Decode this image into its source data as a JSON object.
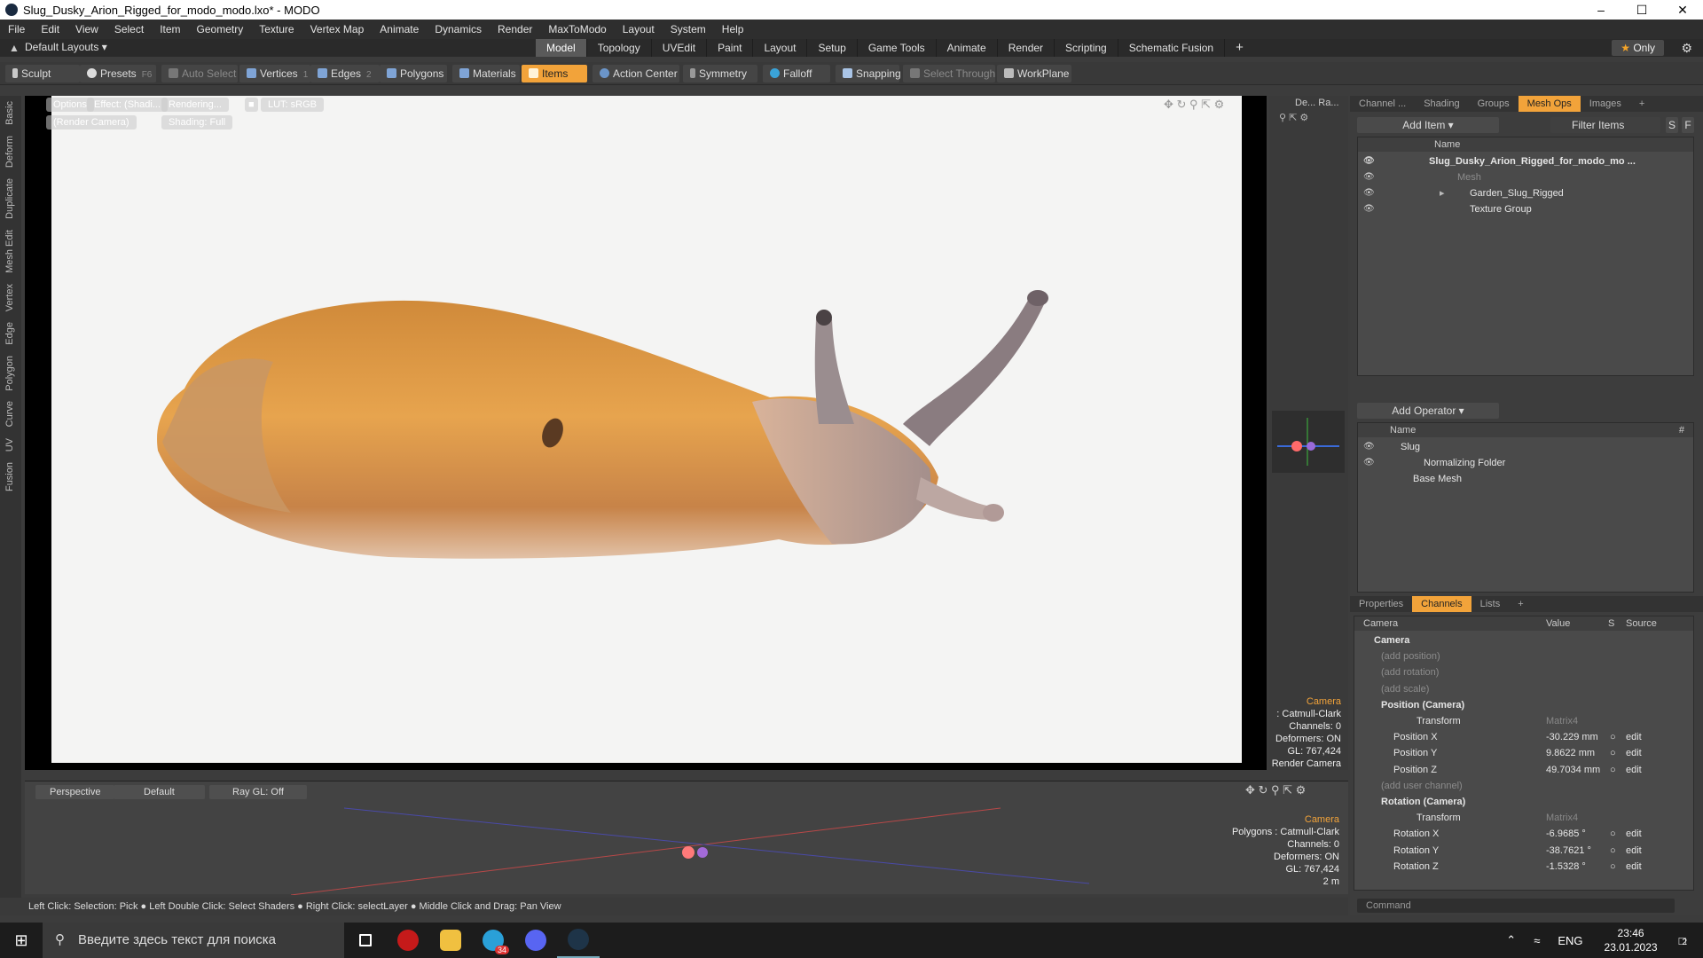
{
  "window": {
    "title": "Slug_Dusky_Arion_Rigged_for_modo_modo.lxo* - MODO"
  },
  "menu": [
    "File",
    "Edit",
    "View",
    "Select",
    "Item",
    "Geometry",
    "Texture",
    "Vertex Map",
    "Animate",
    "Dynamics",
    "Render",
    "MaxToModo",
    "Layout",
    "System",
    "Help"
  ],
  "layout_selector": "Default Layouts",
  "layout_tabs": [
    {
      "label": "Model",
      "active": true
    },
    {
      "label": "Topology"
    },
    {
      "label": "UVEdit"
    },
    {
      "label": "Paint"
    },
    {
      "label": "Layout"
    },
    {
      "label": "Setup"
    },
    {
      "label": "Game Tools"
    },
    {
      "label": "Animate"
    },
    {
      "label": "Render"
    },
    {
      "label": "Scripting"
    },
    {
      "label": "Schematic Fusion"
    }
  ],
  "only_label": "Only",
  "toolbar": {
    "sculpt": "Sculpt",
    "presets": "Presets",
    "presets_key": "F6",
    "auto_select": "Auto Select",
    "vertices": "Vertices",
    "vertices_n": "1",
    "edges": "Edges",
    "edges_n": "2",
    "polygons": "Polygons",
    "materials": "Materials",
    "items": "Items",
    "action_center": "Action Center",
    "symmetry": "Symmetry",
    "falloff": "Falloff",
    "snapping": "Snapping",
    "select_through": "Select Through",
    "workplane": "WorkPlane"
  },
  "left_strip": [
    "Basic",
    "Deform",
    "Duplicate",
    "Mesh Edit",
    "Vertex",
    "Edge",
    "Polygon",
    "Curve",
    "UV",
    "Fusion"
  ],
  "viewport": {
    "options": "Options",
    "effect": "Effect: (Shadi...",
    "rendering": "Rendering...",
    "lut": "LUT: sRGB",
    "render_camera": "(Render Camera)",
    "shading": "Shading: Full",
    "side_header": "De... Ra...",
    "overlay": {
      "camera": "Camera",
      "subdiv": ": Catmull-Clark",
      "channels": "Channels: 0",
      "deformers": "Deformers: ON",
      "gl": "GL: 767,424",
      "render_camera": "Render Camera"
    }
  },
  "bottom_viewport": {
    "perspective": "Perspective",
    "default": "Default",
    "raygl": "Ray GL: Off",
    "overlay": {
      "camera": "Camera",
      "polygons": "Polygons : Catmull-Clark",
      "channels": "Channels: 0",
      "deformers": "Deformers: ON",
      "gl": "GL: 767,424",
      "scale": "2 m"
    }
  },
  "status_bar": "Left Click: Selection: Pick ● Left Double Click: Select Shaders ● Right Click: selectLayer ● Middle Click and Drag: Pan View",
  "items_panel": {
    "tabs": [
      {
        "label": "Channel ..."
      },
      {
        "label": "Shading"
      },
      {
        "label": "Groups"
      },
      {
        "label": "Mesh Ops",
        "active": true
      },
      {
        "label": "Images"
      }
    ],
    "add_item": "Add Item",
    "filter": "Filter Items",
    "col_name": "Name",
    "rows": [
      {
        "label": "Slug_Dusky_Arion_Rigged_for_modo_mo ...",
        "bold": true,
        "indent": 0
      },
      {
        "label": "Mesh",
        "dim": true,
        "indent": 1
      },
      {
        "label": "Garden_Slug_Rigged",
        "indent": 1
      },
      {
        "label": "Texture Group",
        "indent": 1
      }
    ]
  },
  "meshops_panel": {
    "add_operator": "Add Operator",
    "col_name": "Name",
    "col_hash": "#",
    "rows": [
      {
        "label": "Slug",
        "indent": 0
      },
      {
        "label": "Normalizing Folder",
        "indent": 1
      },
      {
        "label": "Base Mesh",
        "indent": 1
      }
    ]
  },
  "channels_panel": {
    "tabs": [
      {
        "label": "Properties"
      },
      {
        "label": "Channels",
        "active": true
      },
      {
        "label": "Lists"
      }
    ],
    "columns": {
      "name": "Camera",
      "value": "Value",
      "s": "S",
      "source": "Source"
    },
    "rows": [
      {
        "name": "Camera",
        "bold": true,
        "value": "",
        "source": ""
      },
      {
        "name": "(add position)",
        "dim": true,
        "value": "",
        "source": ""
      },
      {
        "name": "(add rotation)",
        "dim": true,
        "value": "",
        "source": ""
      },
      {
        "name": "(add scale)",
        "dim": true,
        "value": "",
        "source": ""
      },
      {
        "name": "Position (Camera)",
        "bold": true,
        "value": "",
        "source": ""
      },
      {
        "name": "Transform",
        "value": "Matrix4",
        "dimval": true,
        "source": ""
      },
      {
        "name": "Position X",
        "value": "-30.229 mm",
        "source": "edit"
      },
      {
        "name": "Position Y",
        "value": "9.8622 mm",
        "source": "edit"
      },
      {
        "name": "Position Z",
        "value": "49.7034 mm",
        "source": "edit"
      },
      {
        "name": "(add user channel)",
        "dim": true,
        "value": "",
        "source": ""
      },
      {
        "name": "Rotation (Camera)",
        "bold": true,
        "value": "",
        "source": ""
      },
      {
        "name": "Transform",
        "value": "Matrix4",
        "dimval": true,
        "source": ""
      },
      {
        "name": "Rotation X",
        "value": "-6.9685 °",
        "source": "edit"
      },
      {
        "name": "Rotation Y",
        "value": "-38.7621 °",
        "source": "edit"
      },
      {
        "name": "Rotation Z",
        "value": "-1.5328 °",
        "source": "edit"
      }
    ]
  },
  "command_placeholder": "Command",
  "taskbar": {
    "search": "Введите здесь текст для поиска",
    "lang": "ENG",
    "time": "23:46",
    "date": "23.01.2023",
    "notif": "2",
    "telegram_badge": "34"
  },
  "colors": {
    "accent": "#f2a33a",
    "viewport_bg": "#f4f4f3"
  }
}
